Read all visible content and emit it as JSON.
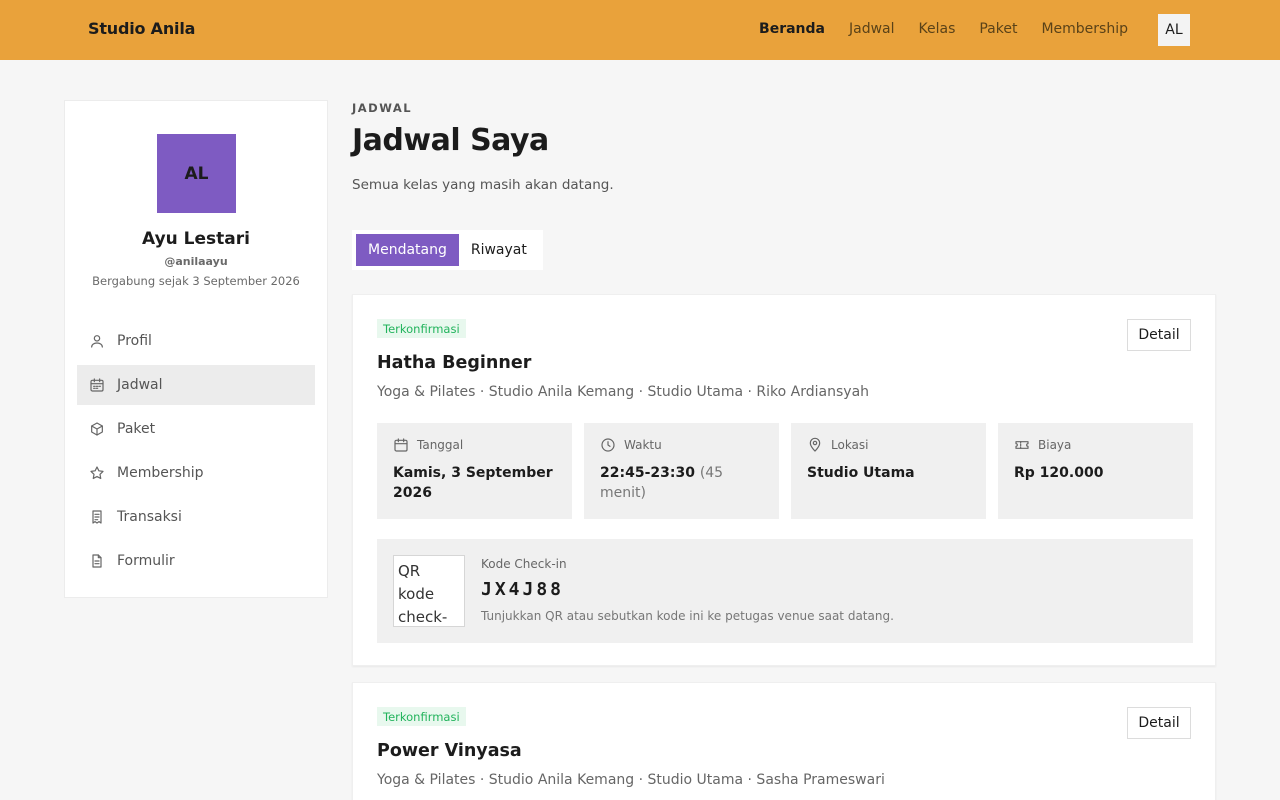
{
  "header": {
    "brand": "Studio Anila",
    "nav": [
      "Beranda",
      "Jadwal",
      "Kelas",
      "Paket",
      "Membership"
    ],
    "avatar_initials": "AL"
  },
  "sidebar": {
    "avatar_initials": "AL",
    "avatar_color": "#7e5bc2",
    "name": "Ayu Lestari",
    "handle": "@anilaayu",
    "since": "Bergabung sejak 3 September 2026",
    "items": [
      {
        "label": "Profil",
        "icon": "user-icon"
      },
      {
        "label": "Jadwal",
        "icon": "calendar-icon"
      },
      {
        "label": "Paket",
        "icon": "box-icon"
      },
      {
        "label": "Membership",
        "icon": "star-icon"
      },
      {
        "label": "Transaksi",
        "icon": "receipt-icon"
      },
      {
        "label": "Formulir",
        "icon": "document-icon"
      }
    ]
  },
  "main": {
    "eyebrow": "JADWAL",
    "title": "Jadwal Saya",
    "subtitle": "Semua kelas yang masih akan datang.",
    "tabs": [
      "Mendatang",
      "Riwayat"
    ],
    "bookings": [
      {
        "status": "Terkonfirmasi",
        "detail_label": "Detail",
        "title": "Hatha Beginner",
        "meta": "Yoga & Pilates · Studio Anila Kemang · Studio Utama · Riko Ardiansyah",
        "info": {
          "date_label": "Tanggal",
          "date_value": "Kamis, 3 September 2026",
          "time_label": "Waktu",
          "time_value": "22:45-23:30",
          "time_duration": "(45 menit)",
          "location_label": "Lokasi",
          "location_value": "Studio Utama",
          "cost_label": "Biaya",
          "cost_value": "Rp 120.000"
        },
        "checkin": {
          "qr_alt": "QR kode check-in",
          "label": "Kode Check-in",
          "code": "JX4J88",
          "hint": "Tunjukkan QR atau sebutkan kode ini ke petugas venue saat datang."
        }
      },
      {
        "status": "Terkonfirmasi",
        "detail_label": "Detail",
        "title": "Power Vinyasa",
        "meta": "Yoga & Pilates · Studio Anila Kemang · Studio Utama · Sasha Prameswari"
      }
    ]
  },
  "colors": {
    "header": "#e9a23b",
    "accent": "#7e5bc2",
    "success": "#22b35c"
  }
}
